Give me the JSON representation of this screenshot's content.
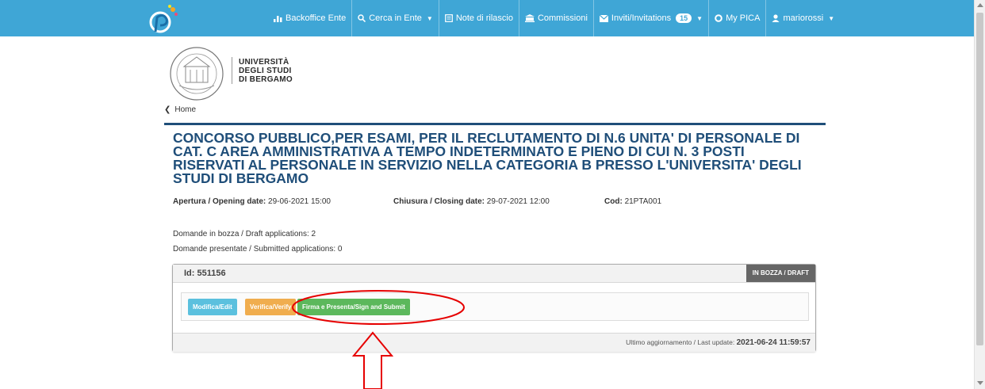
{
  "navbar": {
    "items": [
      {
        "label": "Backoffice Ente",
        "icon": "bar-chart-icon"
      },
      {
        "label": "Cerca in Ente",
        "icon": "search-icon",
        "dropdown": true
      },
      {
        "label": "Note di rilascio",
        "icon": "document-icon"
      },
      {
        "label": "Commissioni",
        "icon": "institution-icon"
      },
      {
        "label": "Inviti/Invitations",
        "icon": "envelope-icon",
        "badge": "15",
        "dropdown": true
      },
      {
        "label": "My PICA",
        "icon": "circle-icon"
      },
      {
        "label": "mariorossi",
        "icon": "user-icon",
        "dropdown": true
      }
    ],
    "color": "#3fa6d6"
  },
  "university": {
    "line1": "UNIVERSITÀ",
    "line2": "DEGLI STUDI",
    "line3": "DI BERGAMO"
  },
  "breadcrumb": {
    "home_label": "Home"
  },
  "page": {
    "title": "CONCORSO PUBBLICO,PER ESAMI, PER IL RECLUTAMENTO DI N.6 UNITA' DI PERSONALE DI CAT. C AREA AMMINISTRATIVA A TEMPO INDETERMINATO E PIENO DI CUI N. 3 POSTI RISERVATI AL PERSONALE IN SERVIZIO NELLA CATEGORIA B PRESSO L'UNIVERSITA' DEGLI STUDI DI BERGAMO",
    "title_color": "#1f4e79",
    "opening_label": "Apertura / Opening date:",
    "opening_value": "29-06-2021 15:00",
    "closing_label": "Chiusura / Closing date:",
    "closing_value": "29-07-2021 12:00",
    "code_label": "Cod:",
    "code_value": "21PTA001",
    "draft_applications": "Domande in bozza / Draft applications: 2",
    "submitted_applications": "Domande presentate / Submitted applications: 0"
  },
  "application": {
    "id_label": "Id: 551156",
    "status": "IN BOZZA / DRAFT",
    "buttons": {
      "edit": "Modifica/Edit",
      "verify": "Verifica/Verify",
      "sign": "Firma e Presenta/Sign and Submit"
    },
    "last_update_label": "Ultimo aggiornamento / Last update:",
    "last_update_value": "2021-06-24 11:59:57"
  },
  "colors": {
    "edit": "#5bc0de",
    "verify": "#f0ad4e",
    "sign": "#5cb85c",
    "annotation": "#e60000"
  }
}
